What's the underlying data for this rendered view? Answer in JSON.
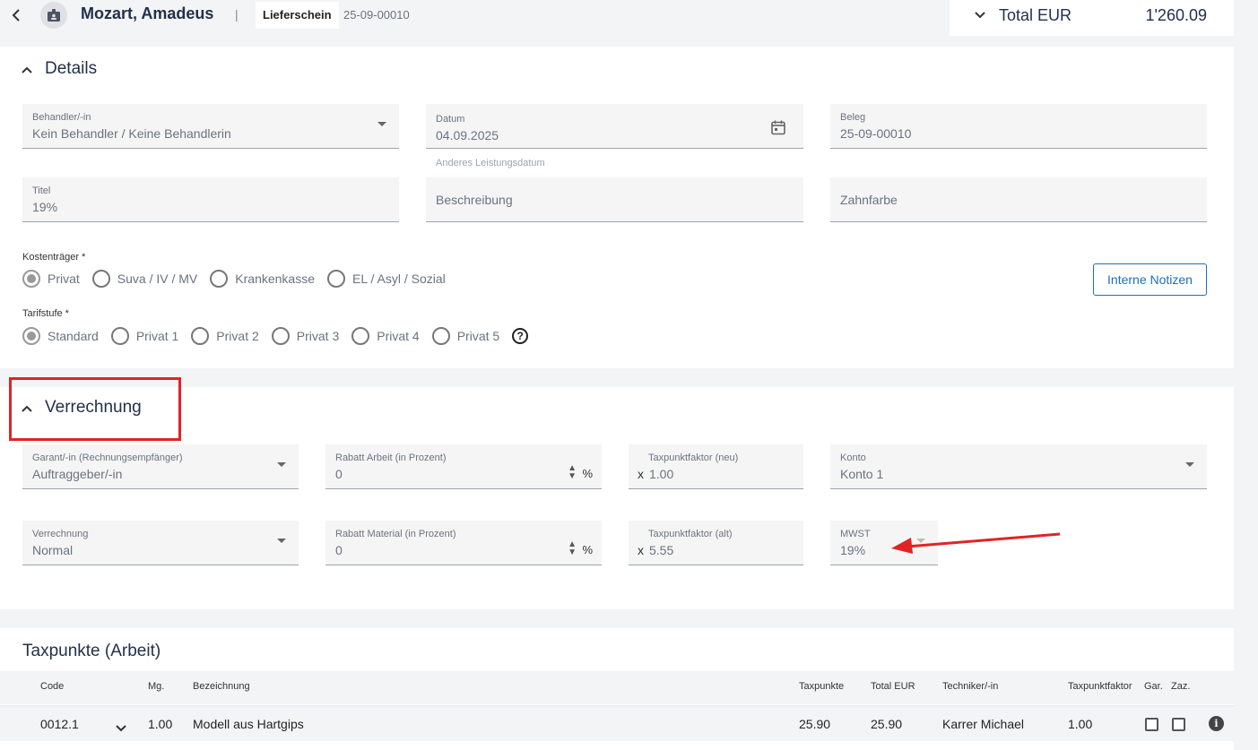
{
  "header": {
    "patient_name": "Mozart, Amadeus",
    "separator": "|",
    "doc_type": "Lieferschein",
    "doc_number": "25-09-00010",
    "total_label": "Total EUR",
    "total_value": "1'260.09"
  },
  "details": {
    "title": "Details",
    "behandler": {
      "label": "Behandler/-in",
      "value": "Kein Behandler / Keine Behandlerin"
    },
    "datum": {
      "label": "Datum",
      "value": "04.09.2025",
      "hint": "Anderes Leistungsdatum"
    },
    "beleg": {
      "label": "Beleg",
      "value": "25-09-00010"
    },
    "titel": {
      "label": "Titel",
      "value": "19%"
    },
    "beschreibung": {
      "placeholder": "Beschreibung"
    },
    "zahnfarbe": {
      "placeholder": "Zahnfarbe"
    },
    "kostentraeger": {
      "label": "Kostenträger *",
      "options": [
        "Privat",
        "Suva / IV / MV",
        "Krankenkasse",
        "EL / Asyl / Sozial"
      ],
      "selected": "Privat"
    },
    "tarifstufe": {
      "label": "Tarifstufe *",
      "options": [
        "Standard",
        "Privat 1",
        "Privat 2",
        "Privat 3",
        "Privat 4",
        "Privat 5"
      ],
      "selected": "Standard"
    },
    "notes_button": "Interne Notizen"
  },
  "verrechnung": {
    "title": "Verrechnung",
    "garant": {
      "label": "Garant/-in (Rechnungsempfänger)",
      "value": "Auftraggeber/-in"
    },
    "rabatt_arbeit": {
      "label": "Rabatt Arbeit (in Prozent)",
      "value": "0",
      "unit": "%"
    },
    "tpf_neu": {
      "label": "Taxpunktfaktor (neu)",
      "prefix": "x",
      "value": "1.00"
    },
    "konto": {
      "label": "Konto",
      "value": "Konto 1"
    },
    "verrechnung_field": {
      "label": "Verrechnung",
      "value": "Normal"
    },
    "rabatt_material": {
      "label": "Rabatt Material (in Prozent)",
      "value": "0",
      "unit": "%"
    },
    "tpf_alt": {
      "label": "Taxpunktfaktor (alt)",
      "prefix": "x",
      "value": "5.55"
    },
    "mwst": {
      "label": "MWST",
      "value": "19%"
    }
  },
  "taxpunkte": {
    "title": "Taxpunkte (Arbeit)",
    "columns": [
      "Code",
      "Mg.",
      "Bezeichnung",
      "Taxpunkte",
      "Total EUR",
      "Techniker/-in",
      "Taxpunktfaktor",
      "Gar.",
      "Zaz."
    ],
    "rows": [
      {
        "code": "0012.1",
        "mg": "1.00",
        "bezeichnung": "Modell aus Hartgips",
        "taxpunkte": "25.90",
        "total": "25.90",
        "techniker": "Karrer Michael",
        "tpf": "1.00"
      }
    ]
  },
  "colors": {
    "accent": "#1d6fb8",
    "annotation": "#e02424",
    "title": "#22304a"
  }
}
